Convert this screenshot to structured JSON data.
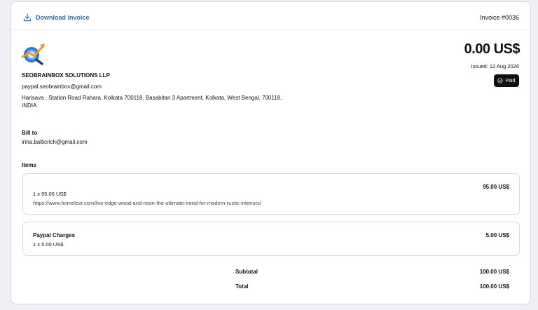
{
  "header": {
    "download_label": "Download invoice",
    "invoice_number": "Invoice #0036"
  },
  "company": {
    "name": "SEOBRAINBOX SOLUTIONS LLP",
    "email": "paypal.seobrainbox@gmail.com",
    "address": "Harisava , Station Road Rahara, Kolkata 700118, Basabitan 3 Apartment, Kolkata, West Bengal, 700118, INDIA"
  },
  "summary": {
    "amount": "0.00 US$",
    "issued": "Issued: 12 Aug 2026",
    "status": "Paid"
  },
  "bill_to": {
    "label": "Bill to",
    "email": "irina.balticrich@gmail.com"
  },
  "items_label": "Items",
  "items": [
    {
      "name": "",
      "qty": "1 x 95.00 US$",
      "url": "https://www.homelovr.com/live-edge-wood-and-resin-the-ultimate-trend-for-modern-rustic-interiors/",
      "total": "95.00 US$"
    },
    {
      "name": "Paypal Charges",
      "qty": "1 x 5.00 US$",
      "url": "",
      "total": "5.00 US$"
    }
  ],
  "totals": {
    "subtotal_label": "Subtotal",
    "subtotal": "100.00 US$",
    "total_label": "Total",
    "total": "100.00 US$"
  },
  "colors": {
    "link": "#1f6fd1",
    "badge_bg": "#111111"
  }
}
